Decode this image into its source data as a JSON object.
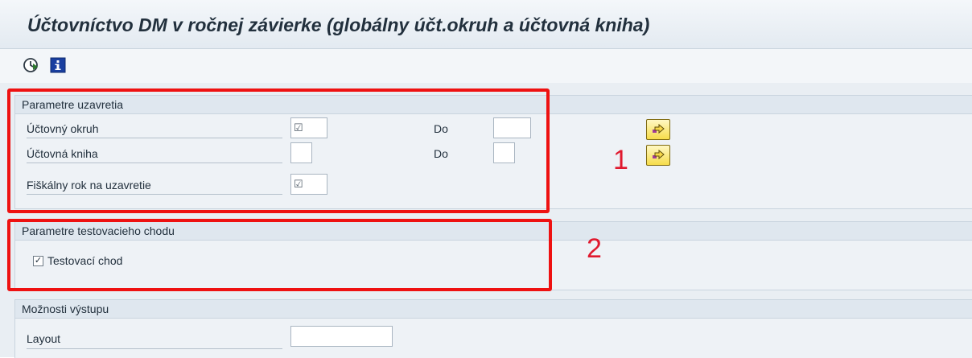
{
  "page": {
    "title": "Účtovníctvo DM v ročnej závierke (globálny účt.okruh a účtovná kniha)"
  },
  "toolbar": {
    "execute_icon": "execute-clock-icon",
    "info_icon": "info-icon"
  },
  "groups": {
    "closing": {
      "header": "Parametre uzavretia",
      "rows": [
        {
          "label": "Účtovný okruh",
          "value": "☑",
          "to_label": "Do",
          "to_value": ""
        },
        {
          "label": "Účtovná kniha",
          "value": "",
          "to_label": "Do",
          "to_value": ""
        },
        {
          "label": "Fiškálny rok na uzavretie",
          "value": "☑"
        }
      ]
    },
    "test": {
      "header": "Parametre testovacieho chodu",
      "checkbox_label": "Testovací chod",
      "checked": true,
      "check_mark": "✓"
    },
    "output": {
      "header": "Možnosti výstupu",
      "layout_label": "Layout",
      "layout_value": ""
    }
  },
  "annotations": {
    "callout_1": "1",
    "callout_2": "2",
    "highlight_color": "#ee1111"
  }
}
